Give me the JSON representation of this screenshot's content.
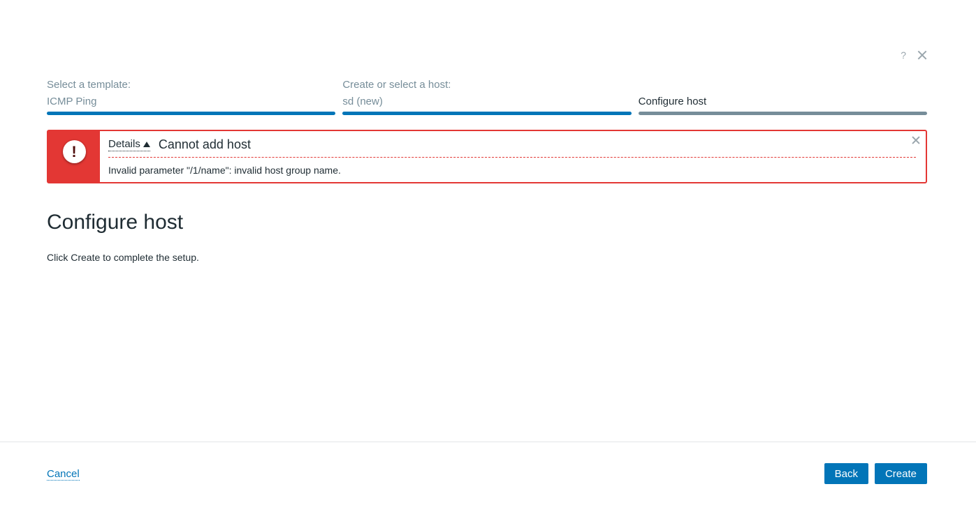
{
  "window": {
    "help_label": "?"
  },
  "stepper": {
    "steps": [
      {
        "title": "Select a template:",
        "value": "ICMP Ping",
        "state": "completed"
      },
      {
        "title": "Create or select a host:",
        "value": "sd (new)",
        "state": "completed"
      },
      {
        "title": "",
        "value": "Configure host",
        "state": "current"
      }
    ]
  },
  "error": {
    "details_label": "Details",
    "title": "Cannot add host",
    "detail": "Invalid parameter \"/1/name\": invalid host group name.",
    "icon_glyph": "!"
  },
  "main": {
    "title": "Configure host",
    "description": "Click Create to complete the setup."
  },
  "footer": {
    "cancel_label": "Cancel",
    "back_label": "Back",
    "create_label": "Create"
  },
  "colors": {
    "accent": "#0275b8",
    "error": "#e33734",
    "muted": "#768d99"
  }
}
